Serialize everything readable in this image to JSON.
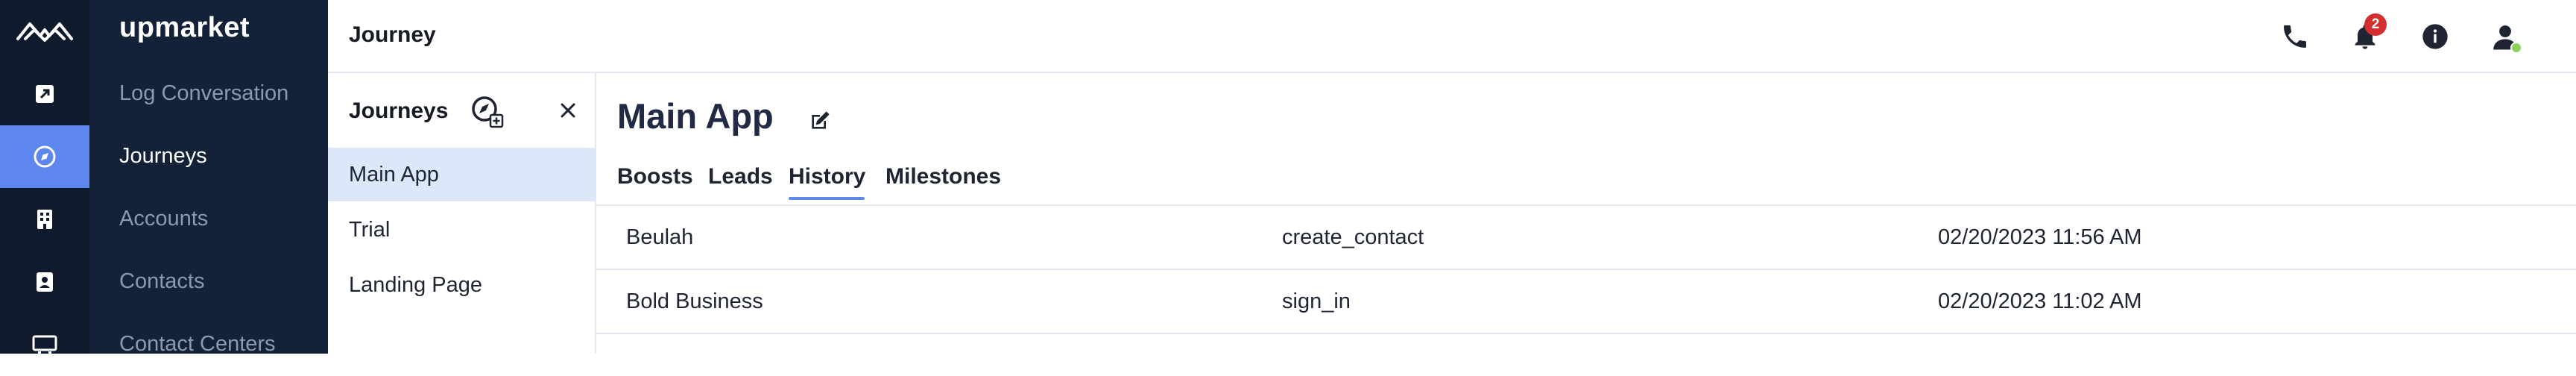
{
  "brand": {
    "name": "upmarket"
  },
  "nav": {
    "items": [
      {
        "label": "Log Conversation",
        "icon": "log-conversation-icon",
        "active": false
      },
      {
        "label": "Journeys",
        "icon": "compass-icon",
        "active": true
      },
      {
        "label": "Accounts",
        "icon": "building-icon",
        "active": false
      },
      {
        "label": "Contacts",
        "icon": "contact-book-icon",
        "active": false
      },
      {
        "label": "Contact Centers",
        "icon": "monitor-icon",
        "active": false
      }
    ]
  },
  "header": {
    "title": "Journey",
    "notification_count": "2",
    "icons": [
      "phone-icon",
      "bell-icon",
      "info-icon",
      "user-icon"
    ]
  },
  "journeys_panel": {
    "title": "Journeys",
    "items": [
      {
        "label": "Main App",
        "selected": true
      },
      {
        "label": "Trial",
        "selected": false
      },
      {
        "label": "Landing Page",
        "selected": false
      }
    ]
  },
  "main": {
    "title": "Main App",
    "tabs": [
      {
        "label": "Boosts",
        "active": false
      },
      {
        "label": "Leads",
        "active": false
      },
      {
        "label": "History",
        "active": true
      },
      {
        "label": "Milestones",
        "active": false
      }
    ],
    "history_rows": [
      {
        "name": "Beulah",
        "event": "create_contact",
        "timestamp": "02/20/2023 11:56 AM"
      },
      {
        "name": "Bold Business",
        "event": "sign_in",
        "timestamp": "02/20/2023 11:02 AM"
      }
    ]
  },
  "colors": {
    "sidebar_dark": "#0f1b2d",
    "sidebar_labels": "#132238",
    "accent": "#5d86ee",
    "selected_row": "#dce8fa",
    "badge": "#d32f2f",
    "presence": "#8bd05c"
  }
}
